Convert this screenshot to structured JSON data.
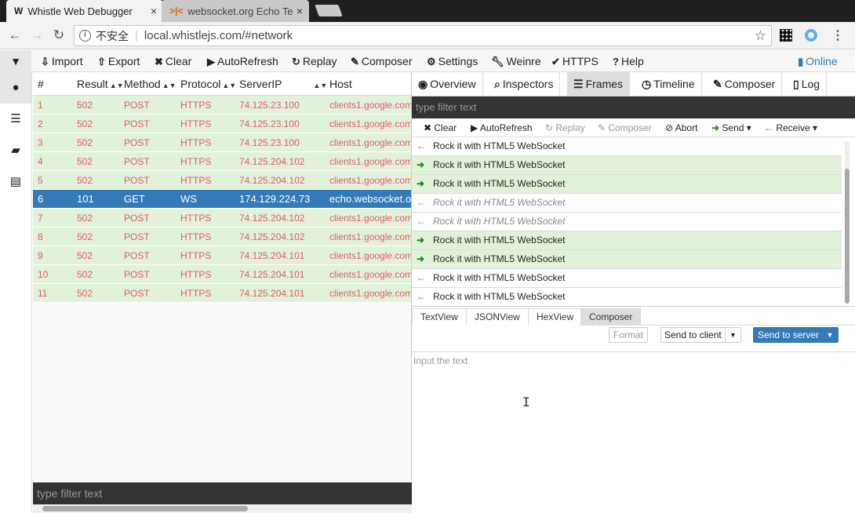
{
  "browser": {
    "tabs": [
      {
        "title": "Whistle Web Debugger",
        "icon": "whistle-w-icon",
        "active": true
      },
      {
        "title": "websocket.org Echo Te",
        "icon": "websocket-icon",
        "active": false
      }
    ],
    "omnibox": {
      "security_label": "不安全",
      "url": "local.whistlejs.com/#network"
    }
  },
  "app_toolbar": {
    "buttons": [
      {
        "label": "Import",
        "icon": "import-icon"
      },
      {
        "label": "Export",
        "icon": "export-icon"
      },
      {
        "label": "Clear",
        "icon": "clear-icon"
      },
      {
        "label": "AutoRefresh",
        "icon": "play-icon"
      },
      {
        "label": "Replay",
        "icon": "replay-icon"
      },
      {
        "label": "Composer",
        "icon": "edit-icon"
      },
      {
        "label": "Settings",
        "icon": "gear-icon"
      },
      {
        "label": "Weinre",
        "icon": "wrench-icon"
      },
      {
        "label": "HTTPS",
        "icon": "check-icon"
      },
      {
        "label": "Help",
        "icon": "help-icon"
      }
    ],
    "online_label": "Online"
  },
  "network": {
    "columns": [
      "#",
      "Result",
      "Method",
      "Protocol",
      "ServerIP",
      "Host"
    ],
    "rows": [
      {
        "num": "1",
        "result": "502",
        "method": "POST",
        "protocol": "HTTPS",
        "ip": "74.125.23.100",
        "host": "clients1.google.com"
      },
      {
        "num": "2",
        "result": "502",
        "method": "POST",
        "protocol": "HTTPS",
        "ip": "74.125.23.100",
        "host": "clients1.google.com"
      },
      {
        "num": "3",
        "result": "502",
        "method": "POST",
        "protocol": "HTTPS",
        "ip": "74.125.23.100",
        "host": "clients1.google.com"
      },
      {
        "num": "4",
        "result": "502",
        "method": "POST",
        "protocol": "HTTPS",
        "ip": "74.125.204.102",
        "host": "clients1.google.com"
      },
      {
        "num": "5",
        "result": "502",
        "method": "POST",
        "protocol": "HTTPS",
        "ip": "74.125.204.102",
        "host": "clients1.google.com"
      },
      {
        "num": "6",
        "result": "101",
        "method": "GET",
        "protocol": "WS",
        "ip": "174.129.224.73",
        "host": "echo.websocket.org"
      },
      {
        "num": "7",
        "result": "502",
        "method": "POST",
        "protocol": "HTTPS",
        "ip": "74.125.204.102",
        "host": "clients1.google.com"
      },
      {
        "num": "8",
        "result": "502",
        "method": "POST",
        "protocol": "HTTPS",
        "ip": "74.125.204.102",
        "host": "clients1.google.com"
      },
      {
        "num": "9",
        "result": "502",
        "method": "POST",
        "protocol": "HTTPS",
        "ip": "74.125.204.101",
        "host": "clients1.google.com"
      },
      {
        "num": "10",
        "result": "502",
        "method": "POST",
        "protocol": "HTTPS",
        "ip": "74.125.204.101",
        "host": "clients1.google.com"
      },
      {
        "num": "11",
        "result": "502",
        "method": "POST",
        "protocol": "HTTPS",
        "ip": "74.125.204.101",
        "host": "clients1.google.com"
      }
    ],
    "selected_num": "6",
    "filter_placeholder": "type filter text"
  },
  "right_panel": {
    "tabs": [
      {
        "label": "Overview",
        "icon": "eye-icon"
      },
      {
        "label": "Inspectors",
        "icon": "search-icon"
      },
      {
        "label": "Frames",
        "icon": "list-icon"
      },
      {
        "label": "Timeline",
        "icon": "clock-icon"
      },
      {
        "label": "Composer",
        "icon": "edit-icon"
      },
      {
        "label": "Log",
        "icon": "file-icon"
      }
    ],
    "active_tab": "Frames",
    "filter_placeholder": "type filter text",
    "frame_toolbar": {
      "clear": "Clear",
      "autorefresh": "AutoRefresh",
      "replay": "Replay",
      "composer": "Composer",
      "abort": "Abort",
      "send": "Send",
      "receive": "Receive"
    },
    "frames": [
      {
        "direction": "receive",
        "text": "Rock it with HTML5 WebSocket",
        "state": "normal"
      },
      {
        "direction": "send",
        "text": "Rock it with HTML5 WebSocket",
        "state": "sent"
      },
      {
        "direction": "send",
        "text": "Rock it with HTML5 WebSocket",
        "state": "sent"
      },
      {
        "direction": "receive",
        "text": "Rock it with HTML5 WebSocket",
        "state": "ignored"
      },
      {
        "direction": "receive",
        "text": "Rock it with HTML5 WebSocket",
        "state": "ignored"
      },
      {
        "direction": "send",
        "text": "Rock it with HTML5 WebSocket",
        "state": "sent"
      },
      {
        "direction": "send",
        "text": "Rock it with HTML5 WebSocket",
        "state": "sent"
      },
      {
        "direction": "receive",
        "text": "Rock it with HTML5 WebSocket",
        "state": "normal"
      },
      {
        "direction": "receive",
        "text": "Rock it with HTML5 WebSocket",
        "state": "normal"
      }
    ],
    "view_tabs": [
      "TextView",
      "JSONView",
      "HexView",
      "Composer"
    ],
    "active_view_tab": "Composer",
    "format_label": "Format",
    "send_client_label": "Send to client",
    "send_server_label": "Send to server",
    "input_placeholder": "Input the text"
  },
  "colors": {
    "selected_row": "#337ab7",
    "row_error_bg": "#e2f2da",
    "row_error_text": "#e0596c",
    "send_arrow": "#1a8c1a",
    "receive_arrow": "#e06020"
  }
}
